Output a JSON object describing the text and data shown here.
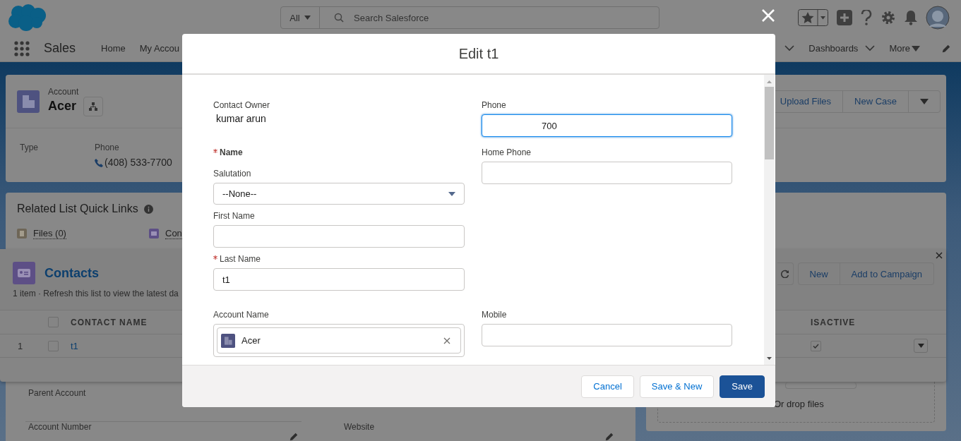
{
  "header": {
    "search_scope": "All",
    "search_placeholder": "Search Salesforce"
  },
  "nav": {
    "app_name": "Sales",
    "items": [
      "Home",
      "My Accou"
    ],
    "right_items": [
      {
        "label": "Dashboards",
        "kind": "chevron"
      },
      {
        "label": "More",
        "kind": "caret"
      }
    ]
  },
  "record": {
    "object": "Account",
    "name": "Acer",
    "actions": [
      "Upload Files",
      "New Case"
    ],
    "fields": [
      {
        "label": "Type"
      },
      {
        "label": "Phone",
        "value": "(408) 533-7700"
      }
    ]
  },
  "quick_links": {
    "title": "Related List Quick Links",
    "links": [
      {
        "label": "Files (0)",
        "kind": "files"
      },
      {
        "label": "Con",
        "kind": "contacts"
      }
    ]
  },
  "details": {
    "fields": [
      {
        "label": "Parent Account"
      },
      {
        "label": "Account Number"
      },
      {
        "label": "Website"
      }
    ]
  },
  "files_card": {
    "drop_text": "Or drop files"
  },
  "contacts_panel": {
    "title": "Contacts",
    "summary": "1 item · Refresh this list to view the latest da",
    "actions": [
      "New",
      "Add to Campaign"
    ],
    "columns": [
      "CONTACT NAME",
      "ISACTIVE"
    ],
    "all_selected": false,
    "rows": [
      {
        "number": "1",
        "selected": false,
        "name": "t1",
        "isactive": true
      }
    ]
  },
  "modal": {
    "title": "Edit t1",
    "rows": [
      {
        "left": [
          {
            "kind": "readonly",
            "label": "Contact Owner",
            "value": "kumar arun",
            "required": false
          }
        ],
        "right": [
          {
            "kind": "text",
            "label": "Phone",
            "value": "700",
            "required": false,
            "focused": true
          }
        ]
      },
      {
        "left": [
          {
            "kind": "heading",
            "label": "Name",
            "required": true
          },
          {
            "kind": "select",
            "label": "Salutation",
            "value": "--None--",
            "required": false
          },
          {
            "kind": "text",
            "label": "First Name",
            "required": false,
            "focused": false
          },
          {
            "kind": "text",
            "label": "Last Name",
            "value": "t1",
            "required": true,
            "focused": false
          }
        ],
        "right": [
          {
            "kind": "text",
            "label": "Home Phone",
            "required": false,
            "focused": false
          }
        ]
      },
      {
        "left": [
          {
            "kind": "lookup",
            "label": "Account Name",
            "value": "Acer",
            "required": false
          }
        ],
        "right": [
          {
            "kind": "text",
            "label": "Mobile",
            "required": false,
            "focused": false
          }
        ]
      }
    ],
    "buttons": [
      {
        "label": "Cancel",
        "kind": "neutral"
      },
      {
        "label": "Save & New",
        "kind": "neutral"
      },
      {
        "label": "Save",
        "kind": "brand"
      }
    ]
  }
}
